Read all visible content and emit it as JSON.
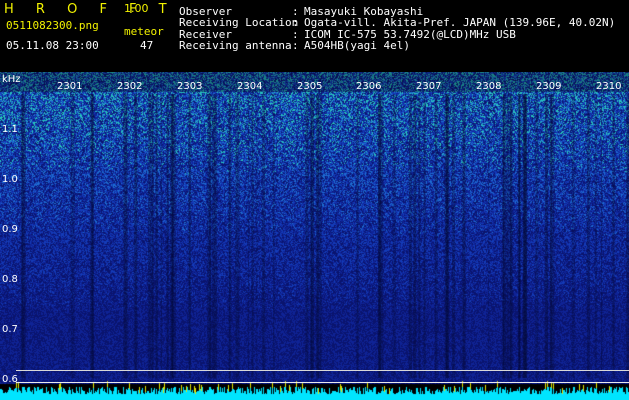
{
  "app": {
    "title": "H R O F F T",
    "version": "1.00"
  },
  "file": {
    "name": "0511082300.png",
    "datetime": "05.11.08 23:00"
  },
  "meteor": {
    "label": "meteor",
    "count": "47"
  },
  "info": [
    {
      "key": "Observer",
      "sep": ":",
      "value": "Masayuki Kobayashi"
    },
    {
      "key": "Receiving Location",
      "sep": ":",
      "value": "Ogata-vill. Akita-Pref. JAPAN (139.96E, 40.02N)"
    },
    {
      "key": "Receiver",
      "sep": ":",
      "value": "ICOM IC-575 53.7492(@LCD)MHz USB"
    },
    {
      "key": "Receiving antenna",
      "sep": ":",
      "value": "A504HB(yagi 4el)"
    }
  ],
  "axis": {
    "unit": "kHz",
    "y_ticks": [
      "1.1",
      "1.0",
      "0.9",
      "0.8",
      "0.7",
      "0.6"
    ],
    "time_ticks": [
      "2301",
      "2302",
      "2303",
      "2304",
      "2305",
      "2306",
      "2307",
      "2308",
      "2309",
      "2310"
    ]
  },
  "colors": {
    "header_text_yellow": "#f2f200",
    "header_text_white": "#ffffff",
    "background": "#000000",
    "spectrogram_base": "#0a1470",
    "noise_band": "#00e5ff"
  }
}
